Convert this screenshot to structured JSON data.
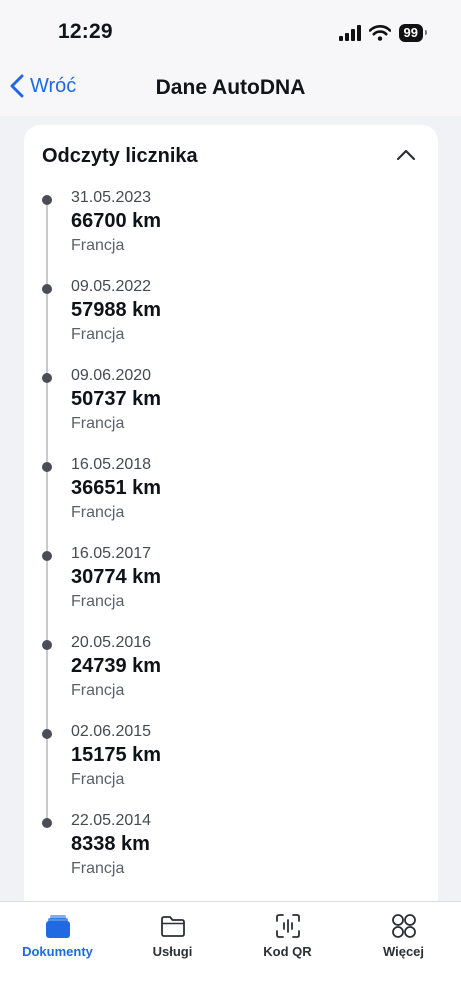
{
  "status_bar": {
    "time": "12:29",
    "battery": "99"
  },
  "nav": {
    "back_label": "Wróć",
    "title": "Dane AutoDNA"
  },
  "card": {
    "title": "Odczyty licznika",
    "entries": [
      {
        "date": "31.05.2023",
        "km": "66700 km",
        "country": "Francja"
      },
      {
        "date": "09.05.2022",
        "km": "57988 km",
        "country": "Francja"
      },
      {
        "date": "09.06.2020",
        "km": "50737 km",
        "country": "Francja"
      },
      {
        "date": "16.05.2018",
        "km": "36651 km",
        "country": "Francja"
      },
      {
        "date": "16.05.2017",
        "km": "30774 km",
        "country": "Francja"
      },
      {
        "date": "20.05.2016",
        "km": "24739 km",
        "country": "Francja"
      },
      {
        "date": "02.06.2015",
        "km": "15175 km",
        "country": "Francja"
      },
      {
        "date": "22.05.2014",
        "km": "8338 km",
        "country": "Francja"
      }
    ]
  },
  "tabs": [
    {
      "label": "Dokumenty",
      "icon": "documents-icon",
      "active": true
    },
    {
      "label": "Usługi",
      "icon": "folder-icon",
      "active": false
    },
    {
      "label": "Kod QR",
      "icon": "qr-code-icon",
      "active": false
    },
    {
      "label": "Więcej",
      "icon": "more-icon",
      "active": false
    }
  ],
  "colors": {
    "accent": "#1f6ae0",
    "background": "#f1f2f6",
    "card": "#ffffff",
    "dot": "#4a4d55"
  }
}
